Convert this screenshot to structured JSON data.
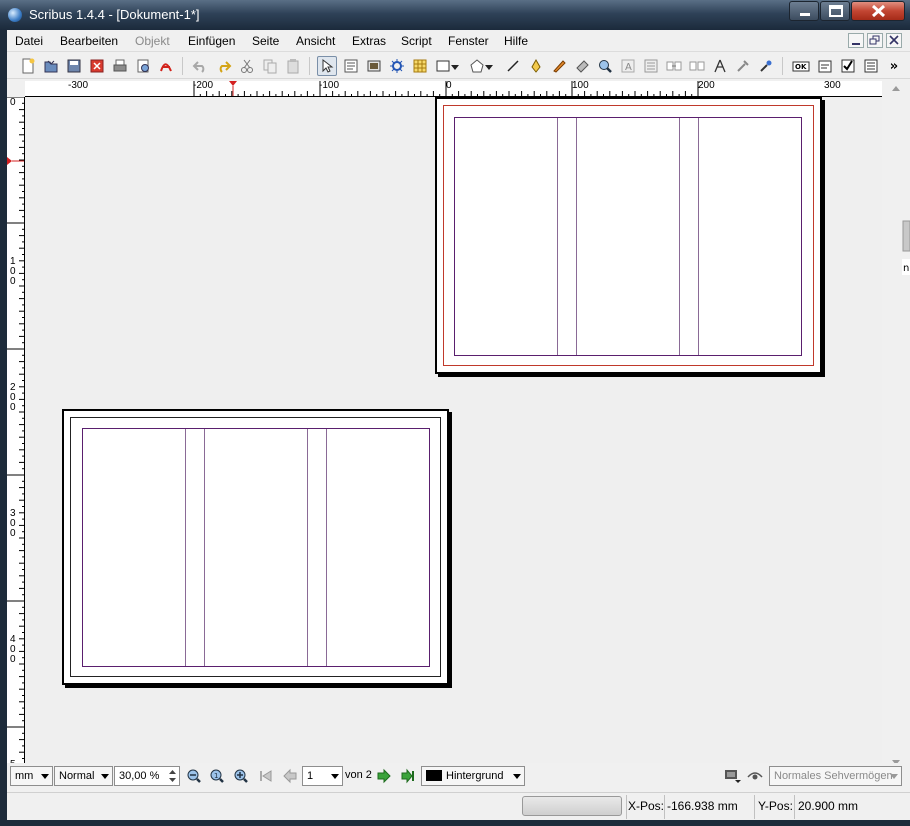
{
  "window": {
    "title": "Scribus 1.4.4 - [Dokument-1*]"
  },
  "menubar": {
    "items": [
      {
        "label": "Datei",
        "disabled": false
      },
      {
        "label": "Bearbeiten",
        "disabled": false
      },
      {
        "label": "Objekt",
        "disabled": true
      },
      {
        "label": "Einfügen",
        "disabled": false
      },
      {
        "label": "Seite",
        "disabled": false
      },
      {
        "label": "Ansicht",
        "disabled": false
      },
      {
        "label": "Extras",
        "disabled": false
      },
      {
        "label": "Script",
        "disabled": false
      },
      {
        "label": "Fenster",
        "disabled": false
      },
      {
        "label": "Hilfe",
        "disabled": false
      }
    ]
  },
  "toolbar": {
    "icons": [
      "new-document-icon",
      "open-document-icon",
      "save-icon",
      "close-document-icon",
      "print-icon",
      "preflight-check-icon",
      "export-pdf-icon",
      "undo-icon",
      "redo-icon",
      "cut-icon",
      "copy-icon",
      "paste-icon",
      "select-icon",
      "text-frame-icon",
      "image-frame-icon",
      "render-frame-icon",
      "table-icon",
      "shape-icon",
      "polygon-icon",
      "line-icon",
      "bezier-icon",
      "freehand-icon",
      "rotate-icon",
      "zoom-icon",
      "edit-text-icon",
      "story-editor-icon",
      "link-frames-icon",
      "unlink-frames-icon",
      "measure-icon",
      "copy-properties-icon",
      "eyedropper-icon",
      "pdf-pushbutton-icon",
      "pdf-textfield-icon",
      "pdf-checkbox-icon",
      "pdf-combobox-icon"
    ],
    "overflow_label": "»"
  },
  "hruler": {
    "labels": [
      "-300",
      "-200",
      "-100",
      "0",
      "100",
      "200",
      "300"
    ]
  },
  "vruler": {
    "labels": [
      "0",
      "100",
      "200",
      "300",
      "400",
      "5"
    ]
  },
  "bottombar": {
    "unit": "mm",
    "mode": "Normal",
    "zoom": "30,00 %",
    "page_number": "1",
    "page_of": "von 2",
    "layer": "Hintergrund",
    "vision": "Normales Sehvermögen"
  },
  "statusbar": {
    "xpos_label": "X-Pos:",
    "xpos_value": "-166.938 mm",
    "ypos_label": "Y-Pos:",
    "ypos_value": "20.900 mm"
  },
  "colors": {
    "bleed": "#c0392b",
    "margin": "#5a1f6e",
    "column": "#8a6a96",
    "layer_swatch": "#000000",
    "nav_arrow": "#3aa33a"
  }
}
